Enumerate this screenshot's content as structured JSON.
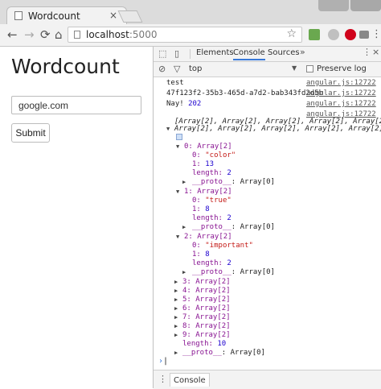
{
  "browser": {
    "tab_title": "Wordcount",
    "tab_close": "×",
    "url_host": "localhost",
    "url_port": ":5000",
    "nav": {
      "back": "←",
      "forward": "→",
      "reload": "⟳",
      "home": "⌂"
    },
    "star": "☆",
    "menu": "⋮",
    "extensions": [
      {
        "name": "puzzle-icon",
        "color": "#6aa84f"
      },
      {
        "name": "ext-icon",
        "color": "#c0c0c0"
      },
      {
        "name": "pinterest-icon",
        "color": "#d0021b"
      },
      {
        "name": "mail-icon",
        "color": "#888888"
      }
    ]
  },
  "page": {
    "heading": "Wordcount",
    "input_value": "google.com",
    "submit_label": "Submit"
  },
  "devtools": {
    "tabs": [
      "Elements",
      "Console",
      "Sources"
    ],
    "active_tab": "Console",
    "more": "»",
    "kebab": "⋮",
    "close": "×",
    "context": "top",
    "preserve_log": "Preserve log",
    "drawer_tab": "Console",
    "log_source": "angular.js:12722",
    "logs": [
      {
        "text": "test"
      },
      {
        "text": "47f123f2-35b3-465d-a7d2-bab343fd2d5b"
      },
      {
        "text": "Nay! ",
        "num": "202"
      }
    ],
    "array_summary_1": "[Array[2], Array[2], Array[2], Array[2], Array[2],",
    "array_summary_2": "Array[2], Array[2], Array[2], Array[2], Array[2]]",
    "expanded": [
      {
        "label": "0: Array[2]",
        "item0_key": "0: ",
        "item0_val": "\"color\"",
        "item1_key": "1: ",
        "item1_val": "13",
        "length_key": "length: ",
        "length_val": "2",
        "proto": "__proto__",
        "proto_val": ": Array[0]"
      },
      {
        "label": "1: Array[2]",
        "item0_key": "0: ",
        "item0_val": "\"true\"",
        "item1_key": "1: ",
        "item1_val": "8",
        "length_key": "length: ",
        "length_val": "2",
        "proto": "__proto__",
        "proto_val": ": Array[0]"
      },
      {
        "label": "2: Array[2]",
        "item0_key": "0: ",
        "item0_val": "\"important\"",
        "item1_key": "1: ",
        "item1_val": "8",
        "length_key": "length: ",
        "length_val": "2",
        "proto": "__proto__",
        "proto_val": ": Array[0]"
      }
    ],
    "collapsed": [
      "3: Array[2]",
      "4: Array[2]",
      "5: Array[2]",
      "6: Array[2]",
      "7: Array[2]",
      "8: Array[2]",
      "9: Array[2]"
    ],
    "length_key": "length: ",
    "length_val": "10",
    "proto_key": "__proto__",
    "proto_val": ": Array[0]",
    "prompt": "›"
  }
}
